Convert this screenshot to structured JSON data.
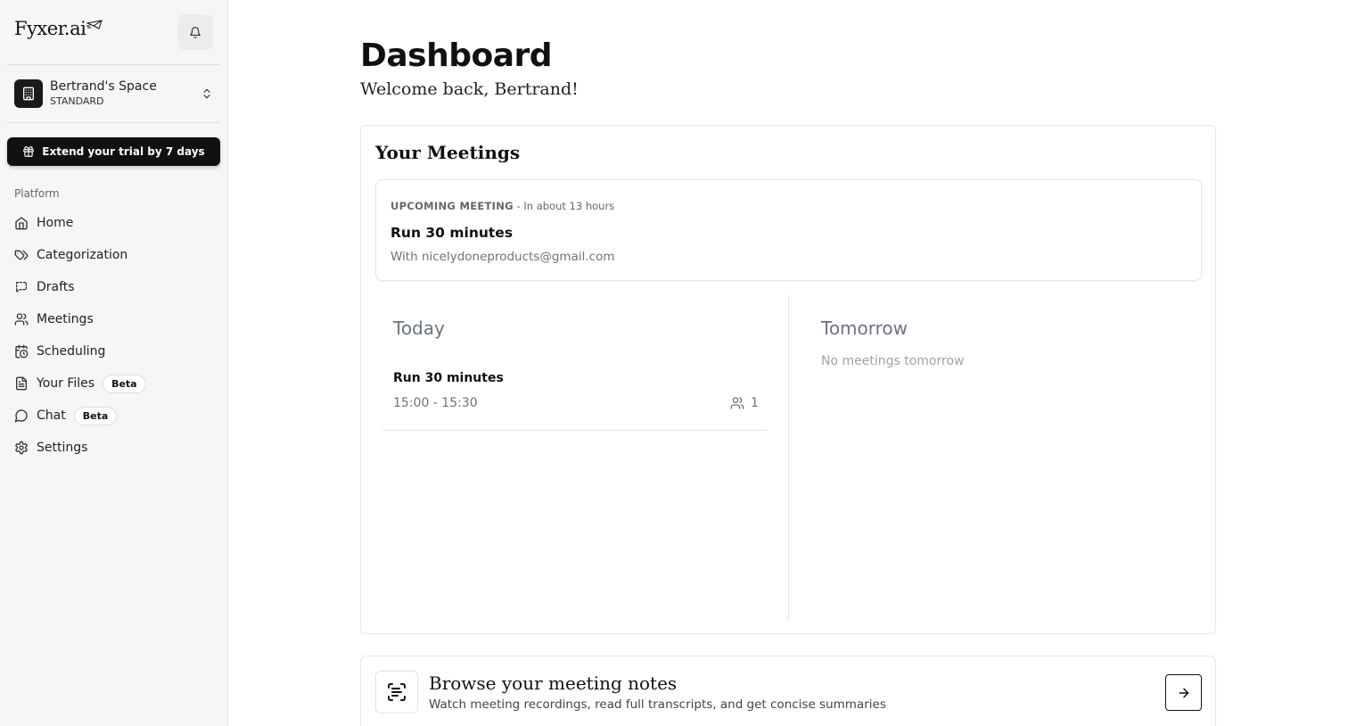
{
  "app": {
    "logo_text": "Fyxer.ai"
  },
  "workspace": {
    "name": "Bertrand's Space",
    "plan": "STANDARD"
  },
  "trial": {
    "label": "Extend your trial by 7 days"
  },
  "sidebar": {
    "section_label": "Platform",
    "items": [
      {
        "label": "Home",
        "icon": "home-icon"
      },
      {
        "label": "Categorization",
        "icon": "tags-icon"
      },
      {
        "label": "Drafts",
        "icon": "drafts-icon"
      },
      {
        "label": "Meetings",
        "icon": "users-icon"
      },
      {
        "label": "Scheduling",
        "icon": "calendar-clock-icon"
      },
      {
        "label": "Your Files",
        "icon": "file-icon",
        "badge": "Beta"
      },
      {
        "label": "Chat",
        "icon": "chat-icon",
        "badge": "Beta"
      },
      {
        "label": "Settings",
        "icon": "gear-icon"
      }
    ]
  },
  "main": {
    "title": "Dashboard",
    "welcome": "Welcome back, Bertrand!",
    "meetings": {
      "title": "Your Meetings",
      "upcoming": {
        "label": "UPCOMING MEETING",
        "when": " - In about 13 hours",
        "name": "Run 30 minutes",
        "with": "With nicelydoneproducts@gmail.com"
      },
      "today": {
        "title": "Today",
        "items": [
          {
            "name": "Run 30 minutes",
            "time": "15:00 - 15:30",
            "attendees": "1"
          }
        ]
      },
      "tomorrow": {
        "title": "Tomorrow",
        "empty": "No meetings tomorrow"
      }
    },
    "notes": {
      "title": "Browse your meeting notes",
      "subtitle": "Watch meeting recordings, read full transcripts, and get concise summaries"
    }
  },
  "colors": {
    "accent": "#111111",
    "muted": "#6b7280",
    "sidebar_bg": "#f6f6f6"
  }
}
